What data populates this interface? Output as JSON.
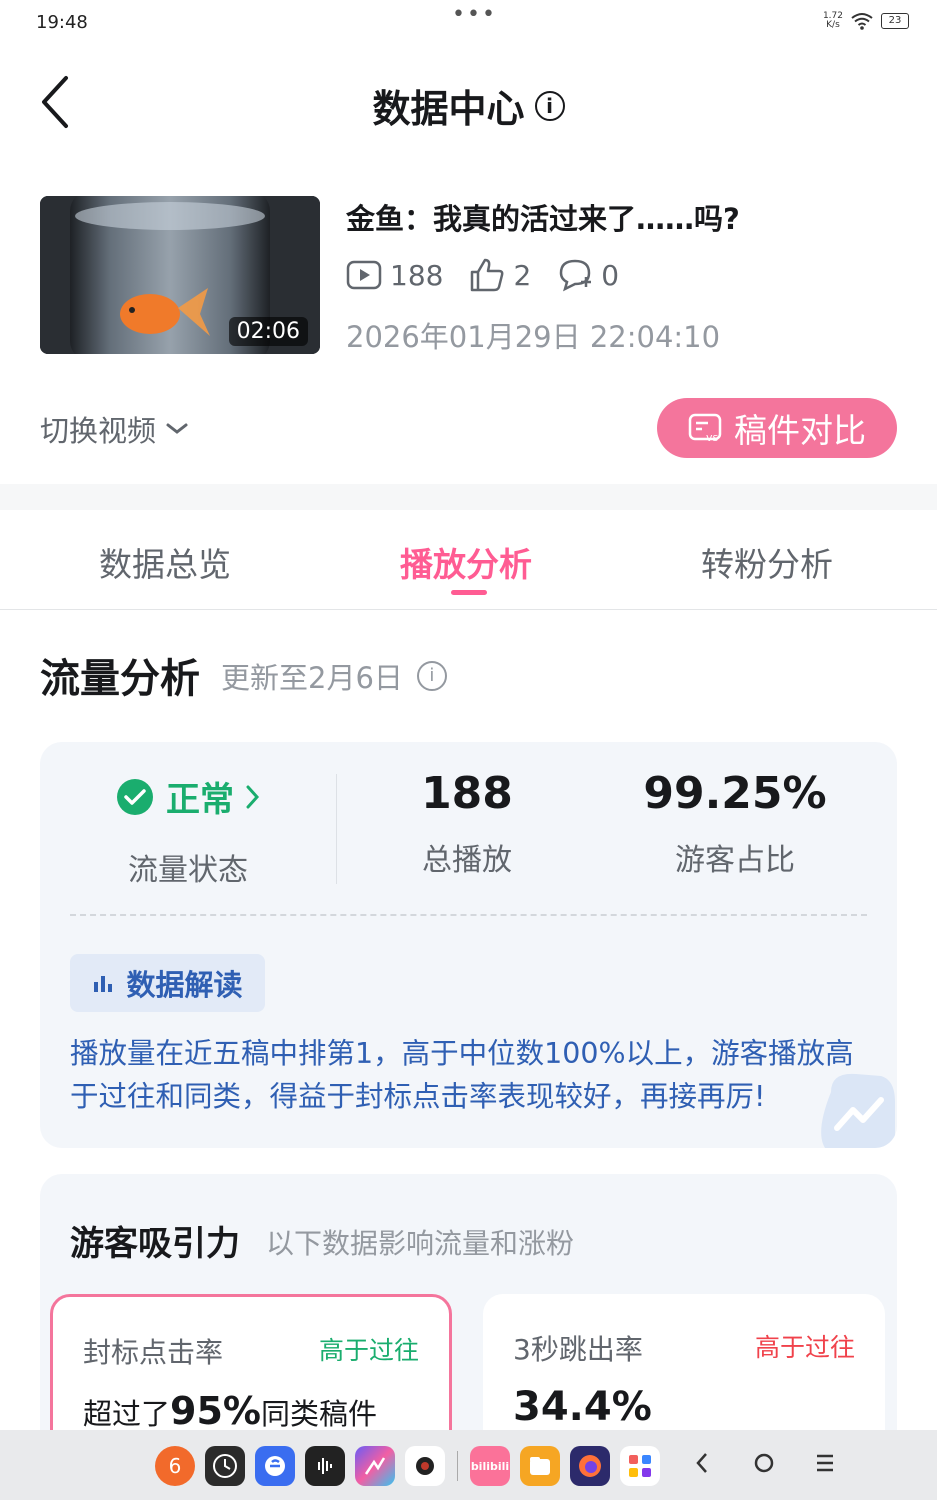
{
  "status_bar": {
    "time": "19:48",
    "dots": "•••",
    "net_speed_value": "1.72",
    "net_speed_unit": "K/s",
    "battery": "23"
  },
  "header": {
    "title": "数据中心",
    "info_glyph": "i"
  },
  "video": {
    "duration": "02:06",
    "title": "金鱼：我真的活过来了……吗?",
    "plays": "188",
    "likes": "2",
    "comments": "0",
    "date": "2026年01月29日 22:04:10"
  },
  "actions": {
    "switch_video": "切换视频",
    "compare": "稿件对比",
    "compare_icon_text": "vs"
  },
  "tabs": [
    {
      "label": "数据总览",
      "active": false
    },
    {
      "label": "播放分析",
      "active": true
    },
    {
      "label": "转粉分析",
      "active": false
    }
  ],
  "flow": {
    "title": "流量分析",
    "updated": "更新至2月6日",
    "status_value": "正常",
    "status_label": "流量状态",
    "total_plays_value": "188",
    "total_plays_label": "总播放",
    "guest_ratio_value": "99.25%",
    "guest_ratio_label": "游客占比",
    "interpret_badge": "数据解读",
    "interpret_text": "播放量在近五稿中排第1，高于中位数100%以上，游客播放高于过往和同类，得益于封标点击率表现较好，再接再厉!"
  },
  "attract": {
    "title": "游客吸引力",
    "subtitle": "以下数据影响流量和涨粉",
    "cards": [
      {
        "label": "封标点击率",
        "tag": "高于过往",
        "prefix": "超过了",
        "value": "95%",
        "suffix": "同类稿件"
      },
      {
        "label": "3秒跳出率",
        "tag": "高于过往",
        "value": "34.4%"
      }
    ]
  },
  "dock": {
    "badge_count": "6",
    "bili_label": "bilibili"
  },
  "colors": {
    "accent": "#ff5c93",
    "compare_bg": "#f4759c",
    "ok_green": "#1aad6e",
    "interpret_blue": "#2f5fb3",
    "tag_green": "#1aad6e",
    "tag_red": "#f0424b"
  }
}
